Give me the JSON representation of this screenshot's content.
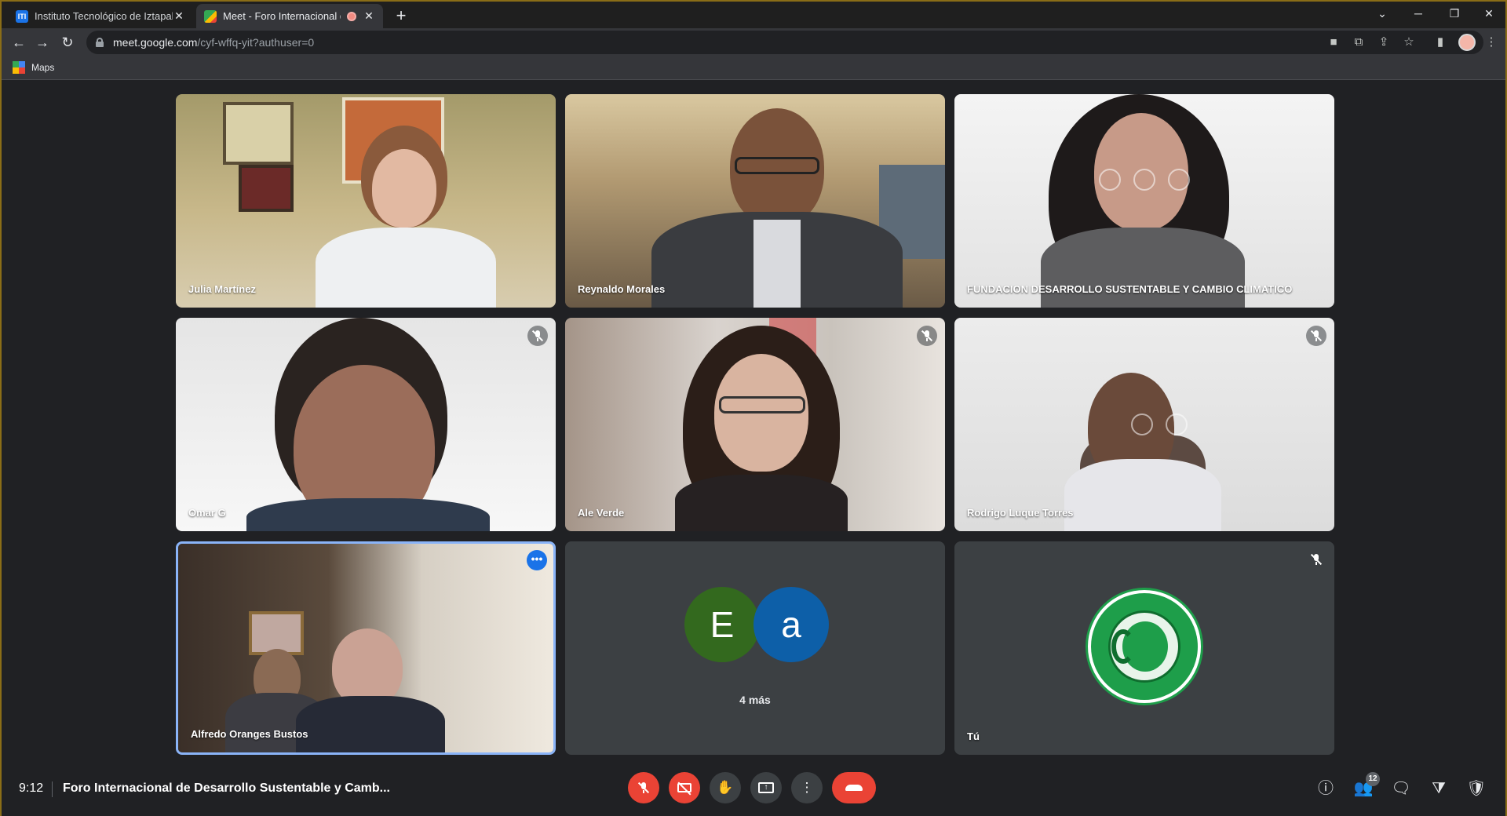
{
  "browser": {
    "tabs": [
      {
        "title": "Instituto Tecnológico de Iztapala",
        "favicon_color": "#1a73e8",
        "favicon_text": "ITI",
        "active": false
      },
      {
        "title": "Meet - Foro Internacional de",
        "favicon_color": "#34a853",
        "active": true,
        "recording": true
      }
    ],
    "close_glyph": "✕",
    "new_tab_glyph": "+",
    "url_host": "meet.google.com",
    "url_path": "/cyf-wffq-yit?authuser=0",
    "bookmarks": [
      {
        "label": "Maps"
      }
    ]
  },
  "tiles": [
    {
      "name": "Julia Martínez",
      "muted": false
    },
    {
      "name": "Reynaldo Morales",
      "muted": false
    },
    {
      "name": "FUNDACION DESARROLLO SUSTENTABLE Y CAMBIO CLIMATICO",
      "muted": false
    },
    {
      "name": "Omar G",
      "muted": true
    },
    {
      "name": "Ale Verde",
      "muted": true
    },
    {
      "name": "Rodrigo Luque Torres",
      "muted": true
    },
    {
      "name": "Alfredo Oranges Bustos",
      "muted": false,
      "pinned_highlight": true
    },
    {
      "avatars": [
        {
          "letter": "E",
          "color": "#33691e"
        },
        {
          "letter": "a",
          "color": "#0d5fa8"
        }
      ],
      "more_label": "4 más"
    },
    {
      "name": "Tú",
      "muted": true,
      "logo": "FUNDACIÓN DESARROLLO SUSTENTABLE CAMBIO CLIMÁTICO"
    }
  ],
  "meeting": {
    "time": "9:12",
    "title": "Foro Internacional de Desarrollo Sustentable y Camb...",
    "participants_count": "12"
  },
  "colors": {
    "accent": "#1a73e8",
    "danger": "#ea4335",
    "bg": "#202124"
  }
}
